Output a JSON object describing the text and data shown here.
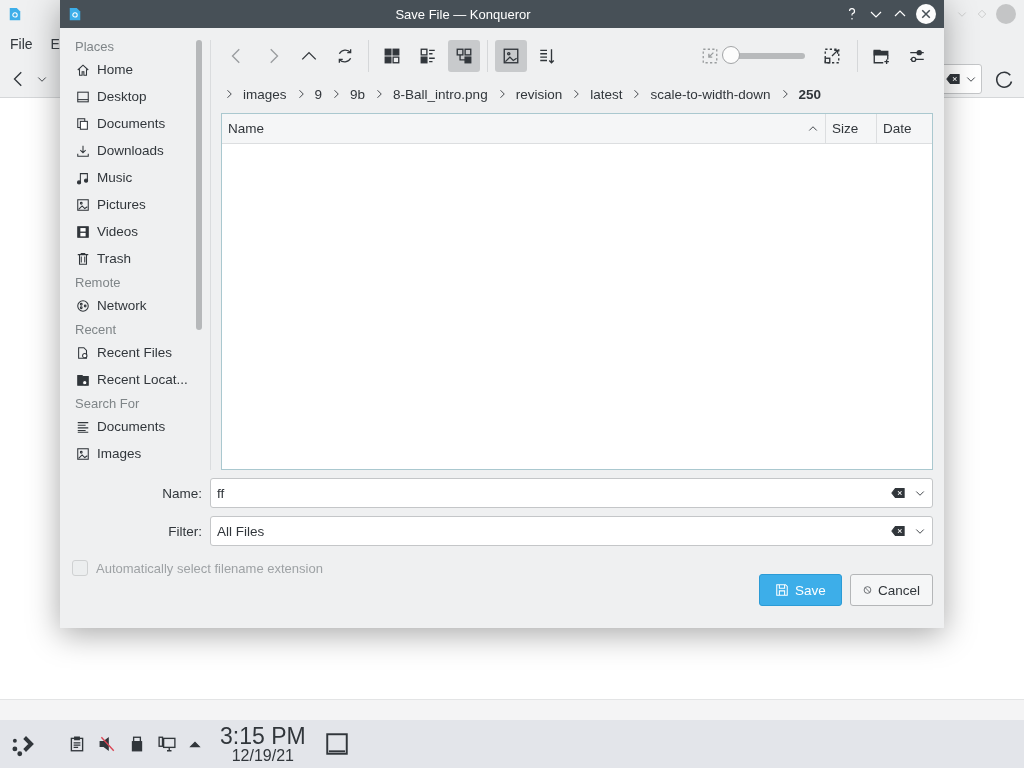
{
  "background_window": {
    "menu": [
      "File",
      "E"
    ]
  },
  "dialog": {
    "title": "Save File — Konqueror",
    "places": [
      {
        "title": "Places",
        "items": [
          {
            "label": "Home",
            "kind": "home"
          },
          {
            "label": "Desktop",
            "kind": "desktop"
          },
          {
            "label": "Documents",
            "kind": "documents"
          },
          {
            "label": "Downloads",
            "kind": "downloads"
          },
          {
            "label": "Music",
            "kind": "music"
          },
          {
            "label": "Pictures",
            "kind": "pictures"
          },
          {
            "label": "Videos",
            "kind": "videos"
          },
          {
            "label": "Trash",
            "kind": "trash"
          }
        ]
      },
      {
        "title": "Remote",
        "items": [
          {
            "label": "Network",
            "kind": "network"
          }
        ]
      },
      {
        "title": "Recent",
        "items": [
          {
            "label": "Recent Files",
            "kind": "recent-file"
          },
          {
            "label": "Recent Locat...",
            "kind": "recent-folder"
          }
        ]
      },
      {
        "title": "Search For",
        "items": [
          {
            "label": "Documents",
            "kind": "text"
          },
          {
            "label": "Images",
            "kind": "pictures"
          }
        ]
      }
    ],
    "view_modes": [
      {
        "kind": "icons",
        "selected": false
      },
      {
        "kind": "compact",
        "selected": false
      },
      {
        "kind": "tree",
        "selected": true
      }
    ],
    "preview": {
      "selected": true
    },
    "zoom": {
      "level": 0
    },
    "breadcrumb": [
      {
        "label": "images",
        "current": false
      },
      {
        "label": "9",
        "current": false
      },
      {
        "label": "9b",
        "current": false
      },
      {
        "label": "8-Ball_intro.png",
        "current": false
      },
      {
        "label": "revision",
        "current": false
      },
      {
        "label": "latest",
        "current": false
      },
      {
        "label": "scale-to-width-down",
        "current": false
      },
      {
        "label": "250",
        "current": true
      }
    ],
    "columns": [
      {
        "label": "Name",
        "sorted": true
      },
      {
        "label": "Size",
        "sorted": false
      },
      {
        "label": "Date",
        "sorted": false
      }
    ],
    "name_field": {
      "label": "Name:",
      "value": "ff"
    },
    "filter_field": {
      "label": "Filter:",
      "value": "All Files"
    },
    "auto_extension": {
      "label": "Automatically select filename extension",
      "checked": false,
      "disabled": true
    },
    "buttons": [
      {
        "label": "Save",
        "kind": "primary"
      },
      {
        "label": "Cancel",
        "kind": "cancel"
      }
    ]
  },
  "taskbar": {
    "time": "3:15 PM",
    "date": "12/19/21"
  }
}
